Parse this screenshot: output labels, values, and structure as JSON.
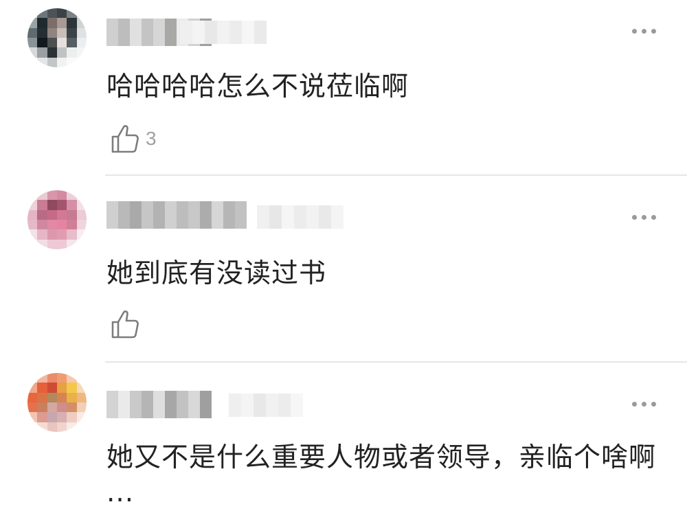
{
  "comments": [
    {
      "text": "哈哈哈哈怎么不说莅临啊",
      "like_count": "3",
      "avatar_colors": [
        "#d8d8d8",
        "#6d767a",
        "#4c5458",
        "#3b4346",
        "#7b8387",
        "#cfd2d3",
        "#9aa3a6",
        "#1f2a2f",
        "#7d6d6a",
        "#a89a95",
        "#2c3538",
        "#d0d3d4",
        "#606b70",
        "#252e33",
        "#8e8480",
        "#c9bdb8",
        "#3a4347",
        "#dfe1e2",
        "#8a9498",
        "#121a1e",
        "#4d4f50",
        "#e5e0de",
        "#565e61",
        "#eceeef",
        "#d6d9da",
        "#9a9fa1",
        "#2b3134",
        "#bfc3c4",
        "#edefef",
        "#f4f5f5",
        "#f7f7f7",
        "#e3e5e6",
        "#c2c6c7",
        "#f1f2f2",
        "#fafafa",
        "#ffffff"
      ],
      "name_colors": [
        "#cfcfcf",
        "#bdbdbd",
        "#e0e0e0",
        "#c4c4c4",
        "#d6d6d6",
        "#a8a8a6",
        "#ebebeb",
        "#d2d2d2",
        "#9e9e9e"
      ],
      "time_colors": [
        "#efefef",
        "#f4f4f4",
        "#e8e8e8",
        "#f2f2f2",
        "#ececec",
        "#f6f6f6",
        "#eaeaea"
      ]
    },
    {
      "text": "她到底有没读过书",
      "like_count": "",
      "avatar_colors": [
        "#f6eef1",
        "#e9c9d3",
        "#d996ab",
        "#d48aa1",
        "#ecd0d9",
        "#f8f1f4",
        "#ecd2db",
        "#c97c93",
        "#8f4a60",
        "#a35570",
        "#d590a7",
        "#f2e0e6",
        "#e3b5c4",
        "#b96a84",
        "#c66b86",
        "#d47896",
        "#c57b92",
        "#eacbd6",
        "#e5b9c8",
        "#d1889f",
        "#e08aa5",
        "#e6849f",
        "#d17e98",
        "#efd5de",
        "#f3e1e7",
        "#e7b6c6",
        "#dd98ae",
        "#e19cb2",
        "#e8bccb",
        "#f7ecf0",
        "#fbf6f8",
        "#f2dde5",
        "#ecc9d5",
        "#eec9d5",
        "#f5e6eb",
        "#ffffff"
      ],
      "name_colors": [
        "#cfcfcf",
        "#b9b9b9",
        "#a9a9a9",
        "#c6c6c6",
        "#b3b3b3",
        "#d0d0d0",
        "#bdbdbd",
        "#c8c8c8",
        "#acacac",
        "#d6d6d6",
        "#b6b6b6",
        "#c2c2c2"
      ],
      "time_colors": [
        "#f0f0f0",
        "#e7e7e7",
        "#f5f5f5",
        "#ececec",
        "#f2f2f2",
        "#e9e9e9",
        "#f4f4f4"
      ]
    },
    {
      "text": "她又不是什么重要人物或者领导，亲临个啥啊···",
      "like_count": "",
      "avatar_colors": [
        "#fbeee8",
        "#f2b59f",
        "#ea8c6c",
        "#ef9c72",
        "#f6c8b0",
        "#fdf4ef",
        "#f0a988",
        "#e5603b",
        "#cf4b33",
        "#e8a044",
        "#f3c84a",
        "#f7d9b9",
        "#e8653e",
        "#d97446",
        "#b0895c",
        "#d58452",
        "#e8b14a",
        "#efb880",
        "#e3724c",
        "#c97f60",
        "#d3a8a0",
        "#cf8d8b",
        "#d58f68",
        "#f2cfb6",
        "#f3c4b3",
        "#dd9b91",
        "#c9a6ad",
        "#d9b0b2",
        "#efcdc0",
        "#faeae2",
        "#fdf5f1",
        "#f5dcd2",
        "#eac5c0",
        "#f0d4cd",
        "#f9ebe6",
        "#ffffff"
      ],
      "name_colors": [
        "#d3d3d3",
        "#eaeaea",
        "#c9c9c9",
        "#b5b5b5",
        "#dedede",
        "#a7a7a7",
        "#c2c2c2",
        "#d8d8d8",
        "#9f9f9f"
      ],
      "time_colors": [
        "#efefef",
        "#f4f4f4",
        "#e8e8e8",
        "#f1f1f1",
        "#ececec",
        "#f6f6f6"
      ]
    }
  ]
}
